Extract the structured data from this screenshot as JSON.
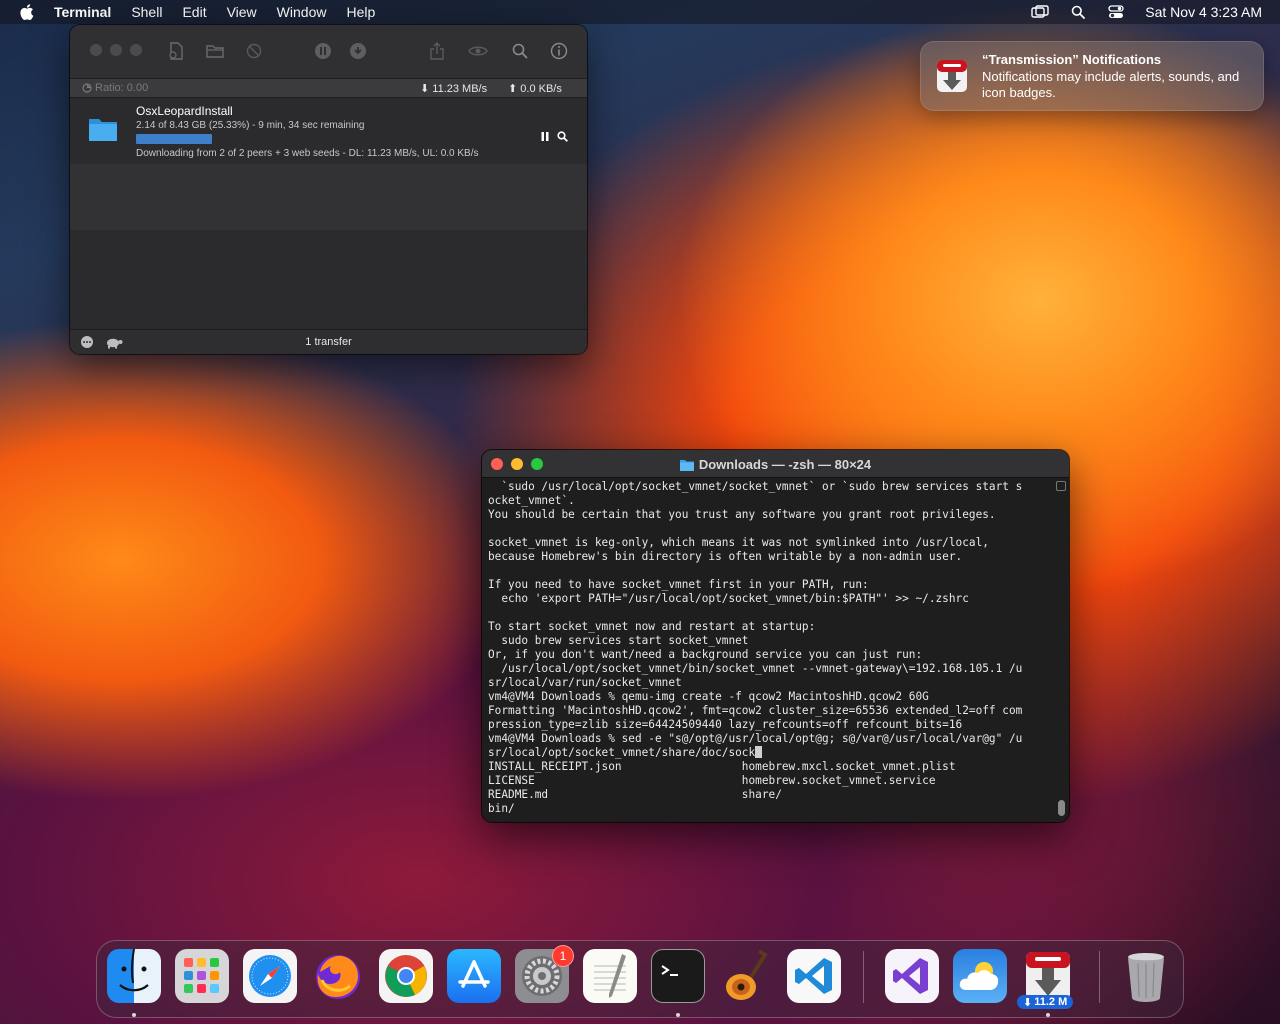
{
  "menubar": {
    "app_name": "Terminal",
    "items": [
      "Shell",
      "Edit",
      "View",
      "Window",
      "Help"
    ],
    "datetime": "Sat Nov 4  3:23 AM"
  },
  "transmission": {
    "ratio_label": "Ratio: 0.00",
    "download_speed": "11.23 MB/s",
    "upload_speed": "0.0 KB/s",
    "torrent": {
      "name": "OsxLeopardInstall",
      "progress_text": "2.14 of 8.43 GB (25.33%) - 9 min, 34 sec remaining",
      "progress_percent": 25.33,
      "status_text": "Downloading from 2 of 2 peers + 3 web seeds - DL: 11.23 MB/s, UL: 0.0 KB/s"
    },
    "footer_count": "1 transfer",
    "colors": {
      "progress": "#3f7fc9",
      "folder": "#3aa0e8"
    }
  },
  "notification": {
    "title": "“Transmission” Notifications",
    "body": "Notifications may include alerts, sounds, and icon badges."
  },
  "terminal": {
    "title": "Downloads — -zsh — 80×24",
    "lines": [
      "  `sudo /usr/local/opt/socket_vmnet/socket_vmnet` or `sudo brew services start s",
      "ocket_vmnet`.",
      "You should be certain that you trust any software you grant root privileges.",
      "",
      "socket_vmnet is keg-only, which means it was not symlinked into /usr/local,",
      "because Homebrew's bin directory is often writable by a non-admin user.",
      "",
      "If you need to have socket_vmnet first in your PATH, run:",
      "  echo 'export PATH=\"/usr/local/opt/socket_vmnet/bin:$PATH\"' >> ~/.zshrc",
      "",
      "To start socket_vmnet now and restart at startup:",
      "  sudo brew services start socket_vmnet",
      "Or, if you don't want/need a background service you can just run:",
      "  /usr/local/opt/socket_vmnet/bin/socket_vmnet --vmnet-gateway\\=192.168.105.1 /u",
      "sr/local/var/run/socket_vmnet",
      "vm4@VM4 Downloads % qemu-img create -f qcow2 MacintoshHD.qcow2 60G",
      "Formatting 'MacintoshHD.qcow2', fmt=qcow2 cluster_size=65536 extended_l2=off com",
      "pression_type=zlib size=64424509440 lazy_refcounts=off refcount_bits=16",
      "vm4@VM4 Downloads % sed -e \"s@/opt@/usr/local/opt@g; s@/var@/usr/local/var@g\" /u",
      "sr/local/opt/socket_vmnet/share/doc/sock",
      "INSTALL_RECEIPT.json                  homebrew.mxcl.socket_vmnet.plist",
      "LICENSE                               homebrew.socket_vmnet.service",
      "README.md                             share/",
      "bin/"
    ]
  },
  "dock": {
    "apps": [
      {
        "name": "Finder",
        "icon": "finder-icon"
      },
      {
        "name": "Launchpad",
        "icon": "launchpad-icon"
      },
      {
        "name": "Safari",
        "icon": "safari-icon"
      },
      {
        "name": "Firefox",
        "icon": "firefox-icon"
      },
      {
        "name": "Chrome",
        "icon": "chrome-icon"
      },
      {
        "name": "App Store",
        "icon": "app-store-icon"
      },
      {
        "name": "System Settings",
        "icon": "gear-icon",
        "badge": "1"
      },
      {
        "name": "TextEdit",
        "icon": "textedit-icon"
      },
      {
        "name": "Terminal",
        "icon": "terminal-icon"
      },
      {
        "name": "GarageBand",
        "icon": "guitar-icon"
      },
      {
        "name": "Visual Studio Code",
        "icon": "vscode-icon"
      },
      {
        "name": "Visual Studio",
        "icon": "visual-studio-icon"
      },
      {
        "name": "Weather",
        "icon": "weather-icon"
      },
      {
        "name": "Transmission",
        "icon": "transmission-icon",
        "badge": "11.2 M"
      },
      {
        "name": "Trash",
        "icon": "trash-icon"
      }
    ]
  }
}
